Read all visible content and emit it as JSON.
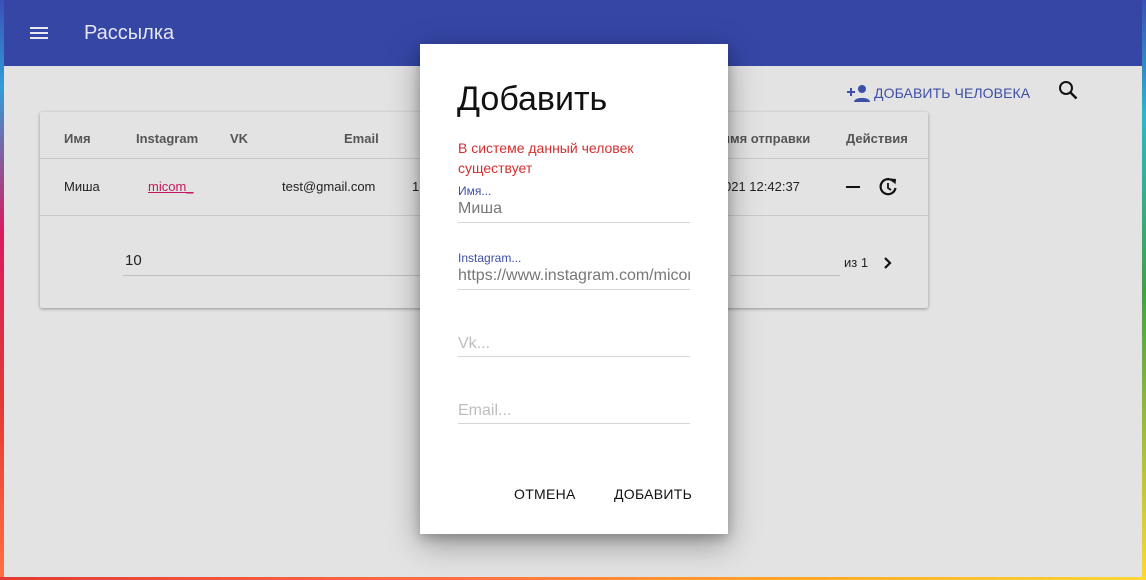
{
  "appbar": {
    "title": "Рассылка",
    "menu_icon": "menu-icon"
  },
  "toolbar": {
    "add_person_label": "ДОБАВИТЬ ЧЕЛОВЕКА",
    "add_person_icon": "person-add-icon",
    "search_icon": "search-icon"
  },
  "table": {
    "headers": {
      "name": "Имя",
      "instagram": "Instagram",
      "vk": "VK",
      "email": "Email",
      "send_time": "имя отправки",
      "actions": "Действия"
    },
    "rows": [
      {
        "name": "Миша",
        "instagram": "micom_",
        "vk": "",
        "email": "test@gmail.com",
        "partial": "1",
        "send_time": "021 12:42:37"
      }
    ],
    "per_page": "10",
    "page_of": "из 1"
  },
  "dialog": {
    "title": "Добавить",
    "error": "В системе данный человек существует",
    "fields": {
      "name": {
        "label": "Имя...",
        "value": "Миша"
      },
      "instagram": {
        "label": "Instagram...",
        "value": "https://www.instagram.com/micom_"
      },
      "vk": {
        "placeholder": "Vk..."
      },
      "email": {
        "placeholder": "Email..."
      }
    },
    "cancel_label": "ОТМЕНА",
    "submit_label": "ДОБАВИТЬ"
  },
  "colors": {
    "appbar": "#3546a5",
    "accent": "#3d4fa6",
    "error": "#d32f2f",
    "link": "#c2185b"
  }
}
